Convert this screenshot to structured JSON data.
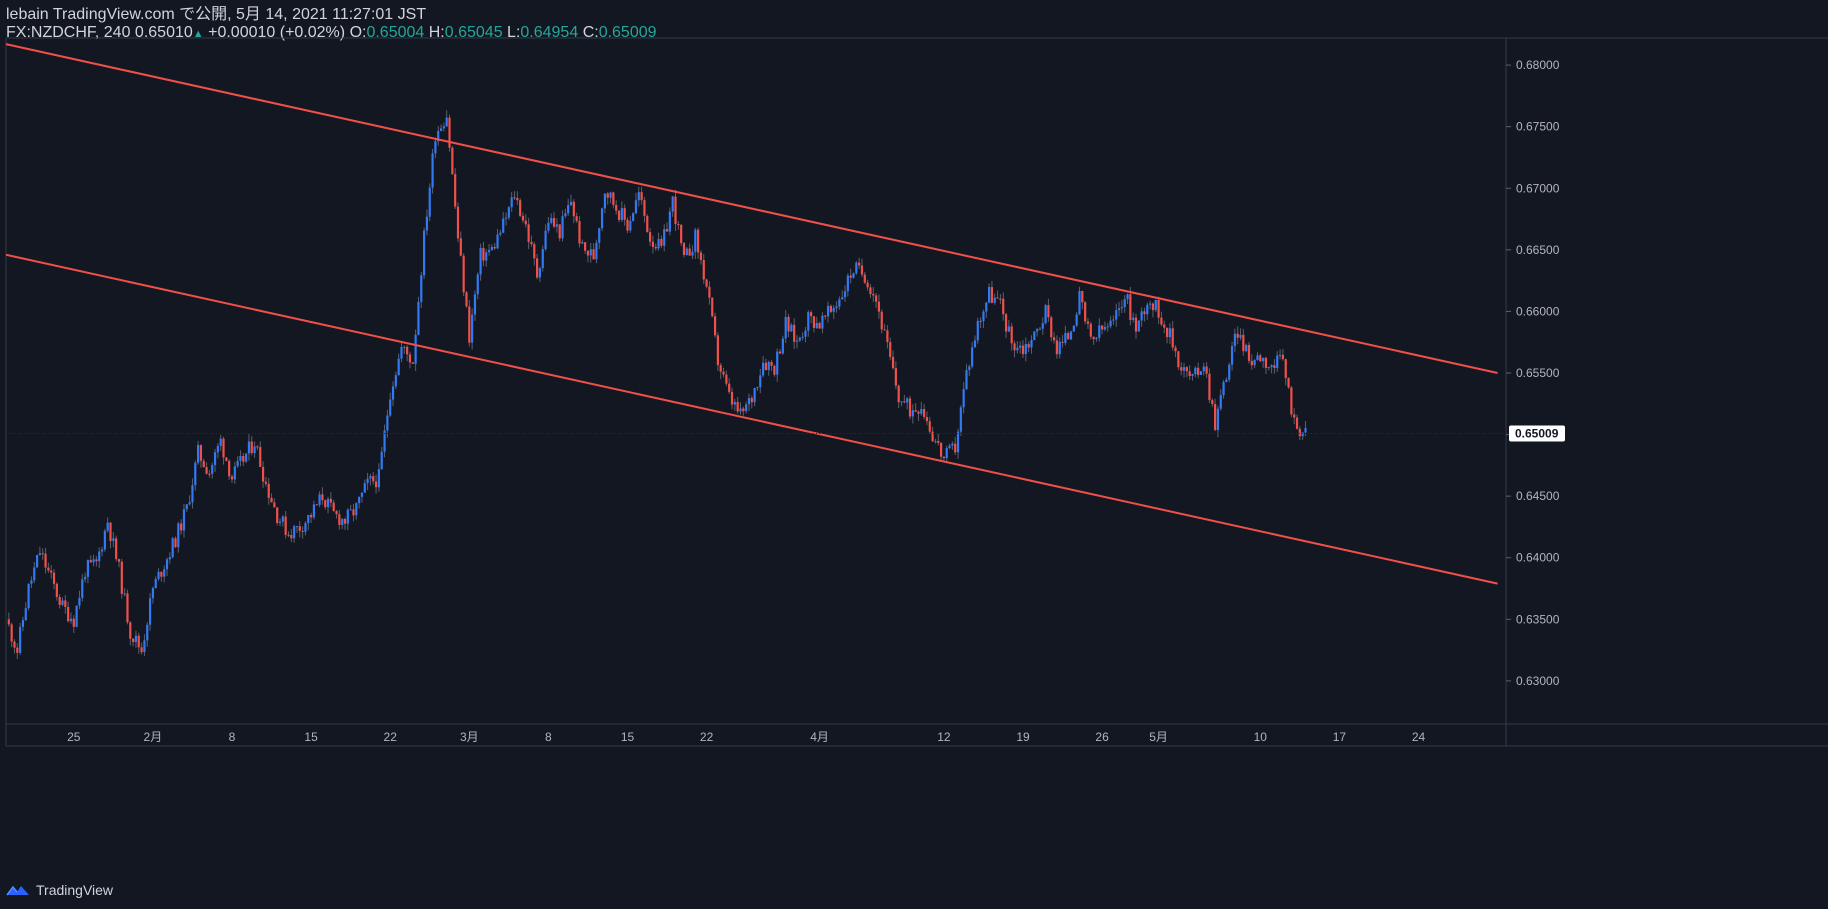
{
  "header": {
    "published": "lebain TradingView.com で公開, 5月 14, 2021 11:27:01 JST",
    "symbol": "FX:NZDCHF, 240",
    "last": "0.65010",
    "change": "+0.00010 (+0.02%)",
    "o_label": "O:",
    "o": "0.65004",
    "h_label": "H:",
    "h": "0.65045",
    "l_label": "L:",
    "l": "0.64954",
    "c_label": "C:",
    "c": "0.65009"
  },
  "footer": {
    "brand": "TradingView"
  },
  "colors": {
    "background": "#131722",
    "up": "#3179f5",
    "down": "#f0504a",
    "wick": "#5d606b",
    "channel": "#f0504a",
    "text": "#b2b5be",
    "price_tag": "#ffffff"
  },
  "chart_data": {
    "type": "candlestick",
    "title": "",
    "xlabel": "",
    "ylabel": "",
    "ylim": [
      0.6265,
      0.6822
    ],
    "y_ticks": [
      "0.63000",
      "0.63500",
      "0.64000",
      "0.64500",
      "0.65000",
      "0.65500",
      "0.66000",
      "0.66500",
      "0.67000",
      "0.67500",
      "0.68000"
    ],
    "current_price_label": "0.65009",
    "x_labels": [
      "25",
      "2月",
      "8",
      "15",
      "22",
      "3月",
      "8",
      "15",
      "22",
      "4月",
      "12",
      "19",
      "26",
      "5月",
      "10",
      "17",
      "24"
    ],
    "close_path": [
      {
        "t": "Jan 19",
        "price": 0.635
      },
      {
        "t": "Jan 20",
        "price": 0.6325
      },
      {
        "t": "Jan 21",
        "price": 0.6375
      },
      {
        "t": "Jan 22",
        "price": 0.6405
      },
      {
        "t": "Jan 24",
        "price": 0.636
      },
      {
        "t": "Jan 25",
        "price": 0.635
      },
      {
        "t": "Jan 26",
        "price": 0.639
      },
      {
        "t": "Jan 27",
        "price": 0.6395
      },
      {
        "t": "Jan 28",
        "price": 0.643
      },
      {
        "t": "Jan 29",
        "price": 0.639
      },
      {
        "t": "Jan 30",
        "price": 0.634
      },
      {
        "t": "Jan 31",
        "price": 0.6325
      },
      {
        "t": "Feb 1",
        "price": 0.6375
      },
      {
        "t": "Feb 2",
        "price": 0.6395
      },
      {
        "t": "Feb 3",
        "price": 0.6415
      },
      {
        "t": "Feb 4",
        "price": 0.644
      },
      {
        "t": "Feb 5",
        "price": 0.6485
      },
      {
        "t": "Feb 6",
        "price": 0.647
      },
      {
        "t": "Feb 7",
        "price": 0.6495
      },
      {
        "t": "Feb 8",
        "price": 0.6465
      },
      {
        "t": "Feb 9",
        "price": 0.648
      },
      {
        "t": "Feb 10",
        "price": 0.6495
      },
      {
        "t": "Feb 11",
        "price": 0.646
      },
      {
        "t": "Feb 12",
        "price": 0.6435
      },
      {
        "t": "Feb 13",
        "price": 0.642
      },
      {
        "t": "Feb 14",
        "price": 0.6425
      },
      {
        "t": "Feb 15",
        "price": 0.6435
      },
      {
        "t": "Feb 16",
        "price": 0.645
      },
      {
        "t": "Feb 17",
        "price": 0.6435
      },
      {
        "t": "Feb 18",
        "price": 0.643
      },
      {
        "t": "Feb 19",
        "price": 0.644
      },
      {
        "t": "Feb 20",
        "price": 0.646
      },
      {
        "t": "Feb 21",
        "price": 0.6465
      },
      {
        "t": "Feb 22",
        "price": 0.6535
      },
      {
        "t": "Feb 23",
        "price": 0.657
      },
      {
        "t": "Feb 24",
        "price": 0.656
      },
      {
        "t": "Feb 25",
        "price": 0.666
      },
      {
        "t": "Feb 26",
        "price": 0.6745
      },
      {
        "t": "Feb 27",
        "price": 0.676
      },
      {
        "t": "Feb 28",
        "price": 0.666
      },
      {
        "t": "Mar 1",
        "price": 0.658
      },
      {
        "t": "Mar 2",
        "price": 0.6645
      },
      {
        "t": "Mar 3",
        "price": 0.665
      },
      {
        "t": "Mar 4",
        "price": 0.667
      },
      {
        "t": "Mar 5",
        "price": 0.6695
      },
      {
        "t": "Mar 6",
        "price": 0.667
      },
      {
        "t": "Mar 7",
        "price": 0.663
      },
      {
        "t": "Mar 8",
        "price": 0.6675
      },
      {
        "t": "Mar 9",
        "price": 0.6665
      },
      {
        "t": "Mar 10",
        "price": 0.669
      },
      {
        "t": "Mar 11",
        "price": 0.665
      },
      {
        "t": "Mar 12",
        "price": 0.6645
      },
      {
        "t": "Mar 13",
        "price": 0.67
      },
      {
        "t": "Mar 14",
        "price": 0.6685
      },
      {
        "t": "Mar 15",
        "price": 0.667
      },
      {
        "t": "Mar 16",
        "price": 0.6695
      },
      {
        "t": "Mar 17",
        "price": 0.666
      },
      {
        "t": "Mar 18",
        "price": 0.665
      },
      {
        "t": "Mar 19",
        "price": 0.669
      },
      {
        "t": "Mar 20",
        "price": 0.664
      },
      {
        "t": "Mar 21",
        "price": 0.666
      },
      {
        "t": "Mar 22",
        "price": 0.662
      },
      {
        "t": "Mar 23",
        "price": 0.656
      },
      {
        "t": "Mar 24",
        "price": 0.653
      },
      {
        "t": "Mar 25",
        "price": 0.6515
      },
      {
        "t": "Mar 26",
        "price": 0.653
      },
      {
        "t": "Mar 27",
        "price": 0.656
      },
      {
        "t": "Mar 28",
        "price": 0.6555
      },
      {
        "t": "Mar 29",
        "price": 0.659
      },
      {
        "t": "Mar 30",
        "price": 0.6575
      },
      {
        "t": "Mar 31",
        "price": 0.6595
      },
      {
        "t": "Apr 1",
        "price": 0.659
      },
      {
        "t": "Apr 2",
        "price": 0.66
      },
      {
        "t": "Apr 3",
        "price": 0.6615
      },
      {
        "t": "Apr 4",
        "price": 0.6635
      },
      {
        "t": "Apr 5",
        "price": 0.663
      },
      {
        "t": "Apr 6",
        "price": 0.661
      },
      {
        "t": "Apr 7",
        "price": 0.657
      },
      {
        "t": "Apr 8",
        "price": 0.653
      },
      {
        "t": "Apr 9",
        "price": 0.652
      },
      {
        "t": "Apr 10",
        "price": 0.6525
      },
      {
        "t": "Apr 11",
        "price": 0.65
      },
      {
        "t": "Apr 12",
        "price": 0.648
      },
      {
        "t": "Apr 13",
        "price": 0.649
      },
      {
        "t": "Apr 14",
        "price": 0.655
      },
      {
        "t": "Apr 15",
        "price": 0.659
      },
      {
        "t": "Apr 16",
        "price": 0.6615
      },
      {
        "t": "Apr 17",
        "price": 0.6605
      },
      {
        "t": "Apr 18",
        "price": 0.6575
      },
      {
        "t": "Apr 19",
        "price": 0.657
      },
      {
        "t": "Apr 20",
        "price": 0.658
      },
      {
        "t": "Apr 21",
        "price": 0.66
      },
      {
        "t": "Apr 22",
        "price": 0.657
      },
      {
        "t": "Apr 23",
        "price": 0.658
      },
      {
        "t": "Apr 24",
        "price": 0.661
      },
      {
        "t": "Apr 25",
        "price": 0.6575
      },
      {
        "t": "Apr 26",
        "price": 0.6585
      },
      {
        "t": "Apr 27",
        "price": 0.659
      },
      {
        "t": "Apr 28",
        "price": 0.6615
      },
      {
        "t": "Apr 29",
        "price": 0.6585
      },
      {
        "t": "Apr 30",
        "price": 0.661
      },
      {
        "t": "May 1",
        "price": 0.66
      },
      {
        "t": "May 2",
        "price": 0.658
      },
      {
        "t": "May 3",
        "price": 0.6555
      },
      {
        "t": "May 4",
        "price": 0.6545
      },
      {
        "t": "May 5",
        "price": 0.656
      },
      {
        "t": "May 6",
        "price": 0.651
      },
      {
        "t": "May 7",
        "price": 0.655
      },
      {
        "t": "May 8",
        "price": 0.6585
      },
      {
        "t": "May 9",
        "price": 0.656
      },
      {
        "t": "May 10",
        "price": 0.6565
      },
      {
        "t": "May 11",
        "price": 0.6555
      },
      {
        "t": "May 12",
        "price": 0.656
      },
      {
        "t": "May 13",
        "price": 0.651
      },
      {
        "t": "May 14",
        "price": 0.6501
      }
    ],
    "channel_lines": [
      {
        "from": {
          "t": "Jan 19",
          "price": 0.6817
        },
        "to": {
          "t": "May 31",
          "price": 0.655
        }
      },
      {
        "from": {
          "t": "Jan 19",
          "price": 0.6646
        },
        "to": {
          "t": "May 31",
          "price": 0.6379
        }
      }
    ]
  }
}
